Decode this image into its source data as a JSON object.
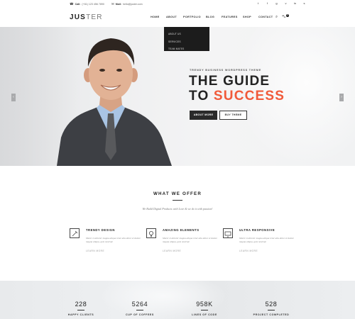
{
  "topbar": {
    "call_label": "Call:",
    "call_value": "(+61) 123 456 7890",
    "mail_label": "Mail:",
    "mail_value": "hello@juster.com",
    "social_icons": [
      "twitter-icon",
      "facebook-icon",
      "google-plus-icon",
      "vimeo-icon",
      "linkedin-icon",
      "skype-icon"
    ]
  },
  "header": {
    "logo_bold": "JUS",
    "logo_thin": "TER",
    "nav": [
      "HOME",
      "ABOUT",
      "PORTFOLIO",
      "BLOG",
      "FEATURES",
      "SHOP",
      "CONTACT"
    ],
    "cart_count": "0"
  },
  "dropdown": {
    "items": [
      "ABOUT US",
      "SERVICES",
      "TEAM MATES"
    ]
  },
  "hero": {
    "tagline": "TRENDY BUSINESS WORDPRESS THEME",
    "line1": "THE GUIDE",
    "line2_prefix": "TO ",
    "line2_accent": "SUCCESS",
    "accent_color": "#f15a3a",
    "btn_primary": "ABOUT MORE",
    "btn_secondary": "BUY THEME"
  },
  "offer": {
    "title": "WHAT WE OFFER",
    "subtitle": "We Build Digital Products with Love & we do it with passion!",
    "features": [
      {
        "icon": "pencil-ruler-icon",
        "title": "TRENDY DESIGN",
        "desc": "Morer et dolorer magna aliqua retur alia dolor et dolore magna aliqua, quis nostrud.",
        "link": "LEARN MORE"
      },
      {
        "icon": "lightbulb-icon",
        "title": "AMAZING ELEMENTS",
        "desc": "Morer et dolorer magna aliqua retur alia dolor et dolore magna aliqua, quis nostrud.",
        "link": "LEARN MORE"
      },
      {
        "icon": "responsive-screen-icon",
        "title": "ULTRA RESPONSIVE",
        "desc": "Morer et dolorer magna aliqua retur alia dolor et dolore magna aliqua, quis nostrud.",
        "link": "LEARN MORE"
      }
    ]
  },
  "counters": [
    {
      "num": "228",
      "label": "HAPPY CLIENTS"
    },
    {
      "num": "5264",
      "label": "CUP OF COFFEES"
    },
    {
      "num": "958K",
      "label": "LINES OF CODE"
    },
    {
      "num": "528",
      "label": "PROJECT COMPLETED"
    }
  ]
}
